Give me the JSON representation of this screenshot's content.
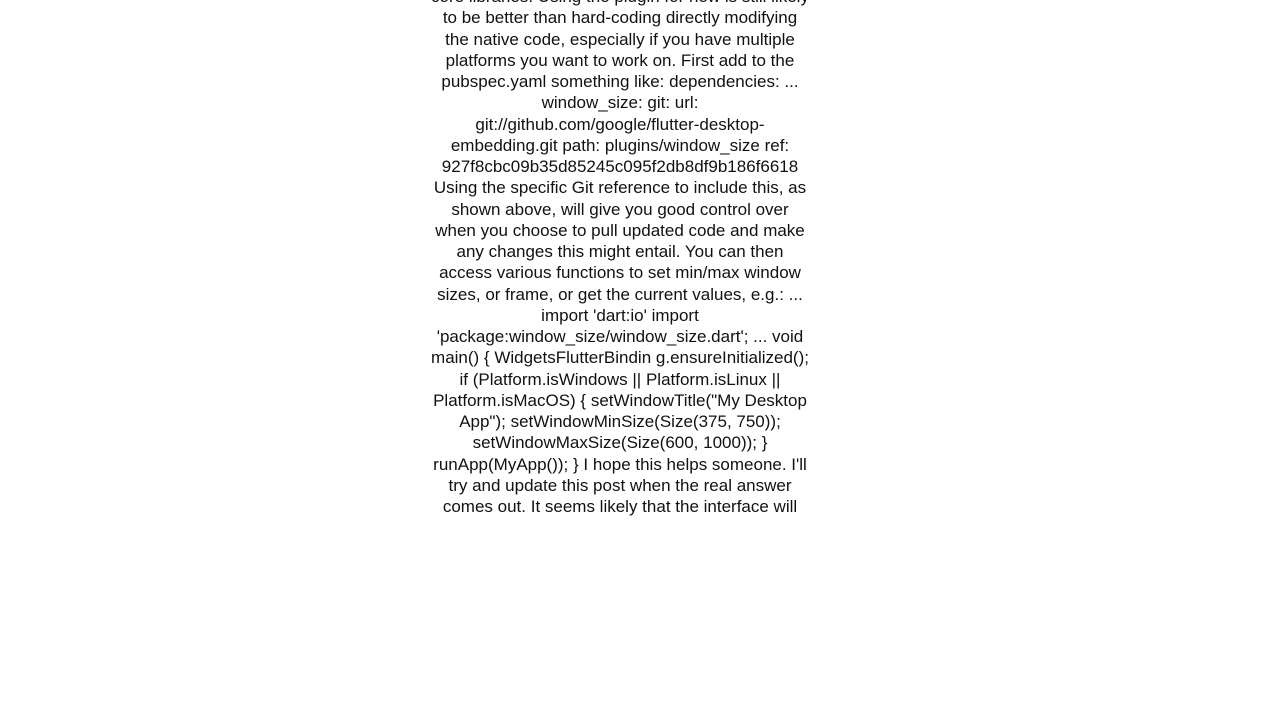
{
  "body": "core libraries. Using the plugin for now is still likely to be better than hard-coding directly modifying the native code, especially if you have multiple platforms you want to work on. First add to the pubspec.yaml something like: dependencies:   ...   window_size:     git:       url: git://github.com/google/flutter-desktop-embedding.git       path: plugins/window_size       ref: 927f8cbc09b35d85245c095f2db8df9b186f6618  Using the specific Git reference to include this, as shown above, will give you good control over when you choose to pull updated code and make any changes this might entail. You can then access various functions to set min/max window sizes, or frame, or get the current values, e.g.: ... import 'dart:io' import 'package:window_size/window_size.dart'; ...  void main() {   WidgetsFlutterBindin g.ensureInitialized();   if (Platform.isWindows || Platform.isLinux || Platform.isMacOS) { setWindowTitle(\"My Desktop App\");     setWindowMinSize(Size(375, 750));     setWindowMaxSize(Size(600, 1000));   }   runApp(MyApp()); }  I hope this helps someone.  I'll try and update this post when the real answer comes out.  It seems likely that the interface will"
}
